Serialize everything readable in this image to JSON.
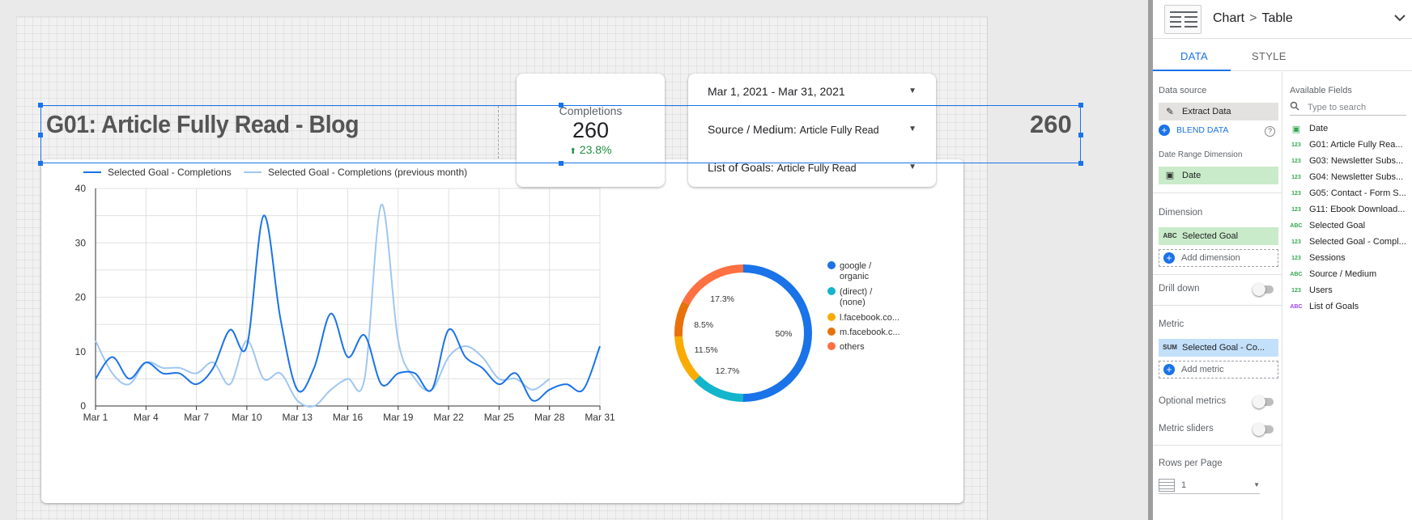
{
  "report": {
    "title": "G01: Article Fully Read - Blog",
    "title_value": "260"
  },
  "scorecard": {
    "label": "Completions",
    "value": "260",
    "delta": "23.8%"
  },
  "filters": [
    {
      "label": "Mar 1, 2021 - Mar 31, 2021",
      "value": ""
    },
    {
      "label": "Source / Medium:",
      "value": "Article Fully Read"
    },
    {
      "label": "List of Goals:",
      "value": "Article Fully Read"
    }
  ],
  "colors": {
    "current": "#1a73e8",
    "previous": "#9fc7f0",
    "google_organic": "#1a73e8",
    "direct_none": "#12b5cb",
    "l_facebook": "#f9ab00",
    "m_facebook": "#e8710a",
    "others": "#ff7043"
  },
  "chart_data": [
    {
      "type": "line",
      "legend": [
        "Selected Goal - Completions",
        "Selected Goal - Completions (previous month)"
      ],
      "x": [
        1,
        2,
        3,
        4,
        5,
        6,
        7,
        8,
        9,
        10,
        11,
        12,
        13,
        14,
        15,
        16,
        17,
        18,
        19,
        20,
        21,
        22,
        23,
        24,
        25,
        26,
        27,
        28,
        29,
        30,
        31
      ],
      "x_tick_labels": [
        "Mar 1",
        "Mar 4",
        "Mar 7",
        "Mar 10",
        "Mar 13",
        "Mar 16",
        "Mar 19",
        "Mar 22",
        "Mar 25",
        "Mar 28",
        "Mar 31"
      ],
      "x_tick_days": [
        1,
        4,
        7,
        10,
        13,
        16,
        19,
        22,
        25,
        28,
        31
      ],
      "ylim": [
        0,
        40
      ],
      "y_ticks": [
        0,
        10,
        20,
        30,
        40
      ],
      "series": [
        {
          "name": "Selected Goal - Completions",
          "values": [
            5,
            9,
            5,
            8,
            6,
            6,
            4,
            7,
            14,
            11,
            35,
            16,
            3,
            7,
            17,
            9,
            13,
            4,
            6,
            6,
            3,
            14,
            9,
            7,
            4,
            6,
            1,
            3,
            4,
            3,
            11
          ]
        },
        {
          "name": "Selected Goal - Completions (previous month)",
          "values": [
            12,
            6,
            4,
            8,
            7,
            7,
            6,
            8,
            4,
            12,
            5,
            6,
            1,
            0,
            3,
            5,
            5,
            37,
            12,
            5,
            3,
            9,
            11,
            9,
            5,
            5,
            3,
            5
          ]
        }
      ],
      "grid": true,
      "legend_position": "top"
    },
    {
      "type": "pie",
      "donut": true,
      "categories": [
        "google / organic",
        "(direct) / (none)",
        "l.facebook.co...",
        "m.facebook.c...",
        "others"
      ],
      "values": [
        50,
        12.7,
        11.5,
        8.5,
        17.3
      ],
      "slice_labels": [
        "50%",
        "12.7%",
        "11.5%",
        "8.5%",
        "17.3%"
      ],
      "legend_position": "right"
    }
  ],
  "panel": {
    "breadcrumb_1": "Chart",
    "breadcrumb_sep": ">",
    "breadcrumb_2": "Table",
    "tabs": [
      "DATA",
      "STYLE"
    ],
    "data_source_label": "Data source",
    "data_source_value": "Extract Data",
    "blend_label": "BLEND DATA",
    "help_glyph": "?",
    "date_range_label": "Date Range Dimension",
    "date_range_value": "Date",
    "dimension_label": "Dimension",
    "dimension_value": "Selected Goal",
    "dimension_tag": "ABC",
    "add_dimension": "Add dimension",
    "drill_down": "Drill down",
    "metric_label": "Metric",
    "metric_tag": "SUM",
    "metric_value": "Selected Goal - Co...",
    "add_metric": "Add metric",
    "optional_metrics": "Optional metrics",
    "metric_sliders": "Metric sliders",
    "rows_per_page_label": "Rows per Page",
    "rows_per_page_value": "1",
    "available_fields_label": "Available Fields",
    "search_placeholder": "Type to search",
    "fields": [
      {
        "type": "cal",
        "tag": "▣",
        "name": "Date"
      },
      {
        "type": "num",
        "tag": "123",
        "name": "G01: Article Fully Rea..."
      },
      {
        "type": "num",
        "tag": "123",
        "name": "G03: Newsletter Subs..."
      },
      {
        "type": "num",
        "tag": "123",
        "name": "G04: Newsletter Subs..."
      },
      {
        "type": "num",
        "tag": "123",
        "name": "G05: Contact - Form S..."
      },
      {
        "type": "num",
        "tag": "123",
        "name": "G11: Ebook Download..."
      },
      {
        "type": "abc",
        "tag": "ABC",
        "name": "Selected Goal"
      },
      {
        "type": "num",
        "tag": "123",
        "name": "Selected Goal - Compl..."
      },
      {
        "type": "num",
        "tag": "123",
        "name": "Sessions"
      },
      {
        "type": "abc",
        "tag": "ABC",
        "name": "Source / Medium"
      },
      {
        "type": "num",
        "tag": "123",
        "name": "Users"
      },
      {
        "type": "abcp",
        "tag": "ABC",
        "name": "List of Goals"
      }
    ]
  }
}
